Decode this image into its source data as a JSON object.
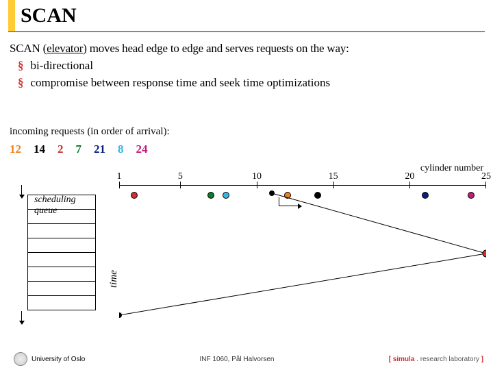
{
  "header": {
    "title": "SCAN"
  },
  "description": {
    "line1_a": "SCAN (",
    "line1_b": "elevator",
    "line1_c": ") moves head edge to edge and serves requests on the way:",
    "b1": "bi-directional",
    "b2": "compromise between response time and seek time optimizations"
  },
  "incoming_label": "incoming requests (in order of arrival):",
  "requests": {
    "r12": "12",
    "r14": "14",
    "r2": "2",
    "r7": "7",
    "r21": "21",
    "r8": "8",
    "r24": "24"
  },
  "cylinder_label": "cylinder number",
  "ticks": {
    "t1": "1",
    "t5": "5",
    "t10": "10",
    "t15": "15",
    "t20": "20",
    "t25": "25"
  },
  "queue_label": "scheduling\nqueue",
  "time_label": "time",
  "footer": {
    "uio": "University of Oslo",
    "course": "INF 1060, Pål Halvorsen",
    "sim_b1": "[ ",
    "sim_b2": "simula",
    "sim_dot": " . ",
    "sim_rest": "research laboratory",
    "sim_b3": " ]"
  },
  "chart_data": {
    "type": "diagram-scan",
    "head_start": 11,
    "cylinder_range": [
      1,
      25
    ],
    "requests_in_arrival_order": [
      12,
      14,
      2,
      7,
      21,
      8,
      24
    ],
    "service_order_scan": [
      12,
      14,
      21,
      24,
      8,
      7,
      2
    ],
    "head_path": [
      [
        11,
        0
      ],
      [
        25,
        1
      ],
      [
        1,
        2
      ]
    ],
    "notes": "SCAN elevator algorithm; head moves right to edge then left serving requests on the way"
  }
}
